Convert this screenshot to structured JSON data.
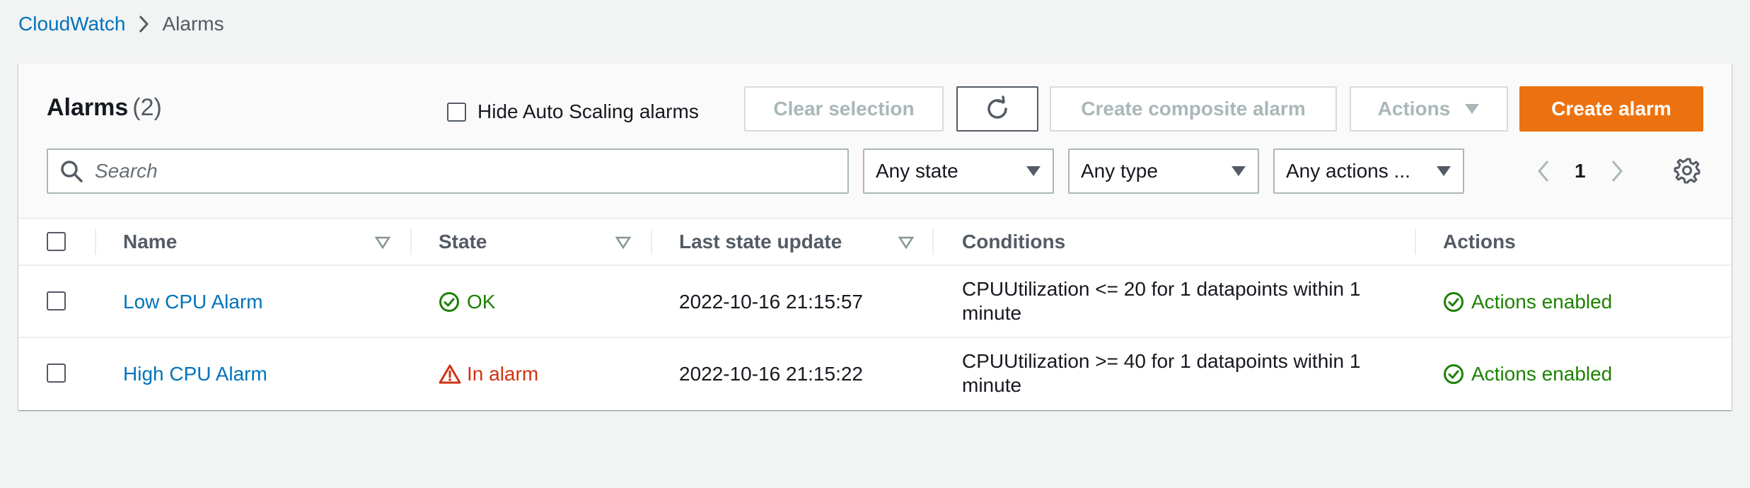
{
  "breadcrumb": {
    "root": "CloudWatch",
    "current": "Alarms"
  },
  "header": {
    "title": "Alarms",
    "count": "(2)",
    "hide_autoscaling_label": "Hide Auto Scaling alarms",
    "clear_selection": "Clear selection",
    "create_composite": "Create composite alarm",
    "actions": "Actions",
    "create_alarm": "Create alarm"
  },
  "filters": {
    "search_placeholder": "Search",
    "state": "Any state",
    "type": "Any type",
    "actions": "Any actions ..."
  },
  "pagination": {
    "page": "1"
  },
  "columns": {
    "name": "Name",
    "state": "State",
    "last_update": "Last state update",
    "conditions": "Conditions",
    "actions": "Actions"
  },
  "rows": [
    {
      "name": "Low CPU Alarm",
      "state": "OK",
      "state_kind": "ok",
      "last_update": "2022-10-16 21:15:57",
      "conditions": "CPUUtilization <= 20 for 1 datapoints within 1 minute",
      "actions": "Actions enabled"
    },
    {
      "name": "High CPU Alarm",
      "state": "In alarm",
      "state_kind": "alarm",
      "last_update": "2022-10-16 21:15:22",
      "conditions": "CPUUtilization >= 40 for 1 datapoints within 1 minute",
      "actions": "Actions enabled"
    }
  ],
  "colors": {
    "link": "#0073bb",
    "primary": "#ec7211",
    "ok": "#1d8102",
    "alarm": "#d13212",
    "text_secondary": "#545b64"
  }
}
